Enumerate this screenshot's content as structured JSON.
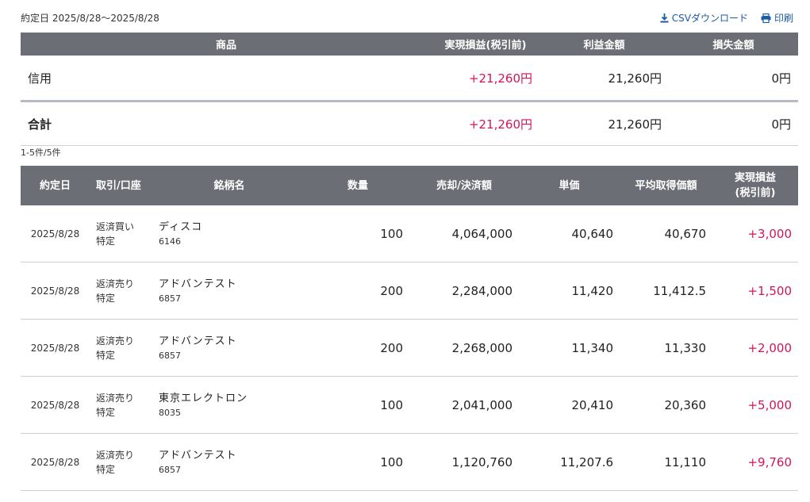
{
  "header": {
    "date_range": "約定日 2025/8/28〜2025/8/28",
    "csv_label": "CSVダウンロード",
    "print_label": "印刷"
  },
  "summary": {
    "columns": [
      "商品",
      "実現損益(税引前)",
      "利益金額",
      "損失金額"
    ],
    "rows": [
      {
        "label": "信用",
        "pnl": "+21,260円",
        "profit": "21,260円",
        "loss": "0円"
      }
    ],
    "total": {
      "label": "合計",
      "pnl": "+21,260円",
      "profit": "21,260円",
      "loss": "0円"
    }
  },
  "count_text": "1-5件/5件",
  "detail": {
    "columns": [
      "約定日",
      "取引/口座",
      "銘柄名",
      "数量",
      "売却/決済額",
      "単価",
      "平均取得価額",
      "実現損益",
      "(税引前)"
    ],
    "rows": [
      {
        "date": "2025/8/28",
        "trade": "返済買い",
        "account": "特定",
        "name": "ディスコ",
        "code": "6146",
        "qty": "100",
        "amount": "4,064,000",
        "price": "40,640",
        "avg": "40,670",
        "pnl": "+3,000"
      },
      {
        "date": "2025/8/28",
        "trade": "返済売り",
        "account": "特定",
        "name": "アドバンテスト",
        "code": "6857",
        "qty": "200",
        "amount": "2,284,000",
        "price": "11,420",
        "avg": "11,412.5",
        "pnl": "+1,500"
      },
      {
        "date": "2025/8/28",
        "trade": "返済売り",
        "account": "特定",
        "name": "アドバンテスト",
        "code": "6857",
        "qty": "200",
        "amount": "2,268,000",
        "price": "11,340",
        "avg": "11,330",
        "pnl": "+2,000"
      },
      {
        "date": "2025/8/28",
        "trade": "返済売り",
        "account": "特定",
        "name": "東京エレクトロン",
        "code": "8035",
        "qty": "100",
        "amount": "2,041,000",
        "price": "20,410",
        "avg": "20,360",
        "pnl": "+5,000"
      },
      {
        "date": "2025/8/28",
        "trade": "返済売り",
        "account": "特定",
        "name": "アドバンテスト",
        "code": "6857",
        "qty": "100",
        "amount": "1,120,760",
        "price": "11,207.6",
        "avg": "11,110",
        "pnl": "+9,760"
      }
    ]
  },
  "colors": {
    "header_bg": "#6b6e75",
    "positive": "#d2145a",
    "link": "#1a5aa6"
  }
}
